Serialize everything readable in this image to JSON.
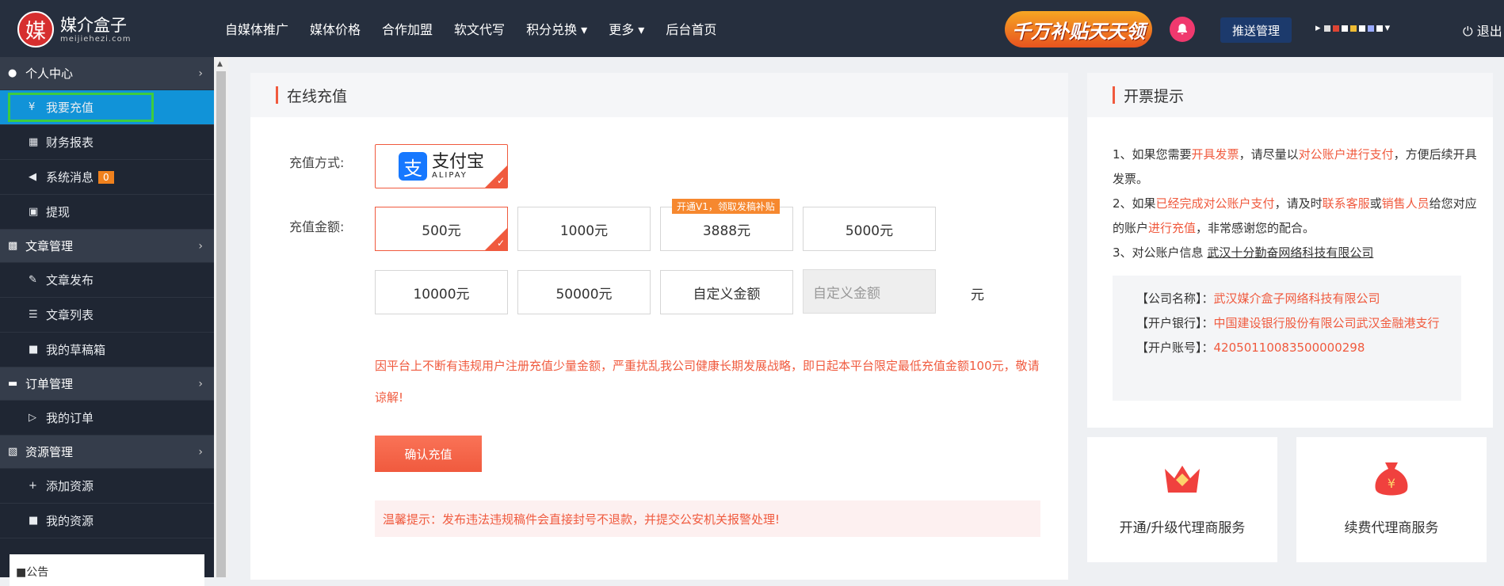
{
  "header": {
    "logo_glyph": "媒",
    "logo_title": "媒介盒子",
    "logo_sub": "meijiehezi.com",
    "nav": [
      "自媒体推广",
      "媒体价格",
      "合作加盟",
      "软文代写",
      "积分兑换 ▾",
      "更多 ▾",
      "后台首页"
    ],
    "promo": "千万补贴天天领",
    "push_label": "推送管理",
    "logout_label": "⏻ 退出"
  },
  "sidebar": {
    "groups": [
      {
        "label": "个人中心",
        "icon": "user-icon",
        "items": [
          {
            "label": "我要充值",
            "icon": "yen-icon"
          },
          {
            "label": "财务报表",
            "icon": "table-icon"
          },
          {
            "label": "系统消息",
            "icon": "speaker-icon",
            "badge": "0"
          },
          {
            "label": "提现",
            "icon": "money-icon"
          }
        ]
      },
      {
        "label": "文章管理",
        "icon": "book-icon",
        "items": [
          {
            "label": "文章发布",
            "icon": "edit-icon"
          },
          {
            "label": "文章列表",
            "icon": "list-icon"
          },
          {
            "label": "我的草稿箱",
            "icon": "video-icon"
          }
        ]
      },
      {
        "label": "订单管理",
        "icon": "folder-icon",
        "items": [
          {
            "label": "我的订单",
            "icon": "cart-icon"
          }
        ]
      },
      {
        "label": "资源管理",
        "icon": "file-icon",
        "items": [
          {
            "label": "添加资源",
            "icon": "plus-icon"
          },
          {
            "label": "我的资源",
            "icon": "video-icon"
          }
        ]
      }
    ],
    "notice": "■公告"
  },
  "recharge": {
    "title": "在线充值",
    "method_label": "充值方式:",
    "alipay_cn": "支付宝",
    "alipay_en": "ALIPAY",
    "amount_label": "充值金额:",
    "amounts": [
      "500元",
      "1000元",
      "3888元",
      "5000元",
      "10000元",
      "50000元",
      "自定义金额"
    ],
    "promo_tag": "开通V1，领取发稿补贴",
    "custom_placeholder": "自定义金额",
    "unit": "元",
    "warning": "因平台上不断有违规用户注册充值少量金额，严重扰乱我公司健康长期发展战略，即日起本平台限定最低充值金额100元，敬请谅解!",
    "confirm_label": "确认充值",
    "tip": "温馨提示：发布违法违规稿件会直接封号不退款，并提交公安机关报警处理!"
  },
  "invoice": {
    "title": "开票提示",
    "l1a": "1、如果您需要",
    "l1b": "开具发票",
    "l1c": "，请尽量以",
    "l1d": "对公账户进行支付",
    "l1e": "，方便后续开具发票。",
    "l2a": "2、如果",
    "l2b": "已经完成对公账户支付",
    "l2c": "，请及时",
    "l2d": "联系客服",
    "l2e": "或",
    "l2f": "销售人员",
    "l2g": "给您对应的账户",
    "l2h": "进行充值",
    "l2i": "，非常感谢您的配合。",
    "l3a": "3、对公账户信息 ",
    "l3b": "武汉十分勤奋网络科技有限公司",
    "company_label": "【公司名称】：",
    "company": "武汉媒介盒子网络科技有限公司",
    "bank_label": "【开户银行】：",
    "bank": "中国建设银行股份有限公司武汉金融港支行",
    "account_label": "【开户账号】：",
    "account": "42050110083500000298"
  },
  "services": [
    {
      "label": "开通/升级代理商服务",
      "icon": "crown-icon"
    },
    {
      "label": "续费代理商服务",
      "icon": "money-bag-icon"
    }
  ],
  "colors": {
    "accent": "#f05a3e",
    "sidebar": "#1f2633",
    "active": "#1193d8",
    "header": "#262f3e"
  }
}
